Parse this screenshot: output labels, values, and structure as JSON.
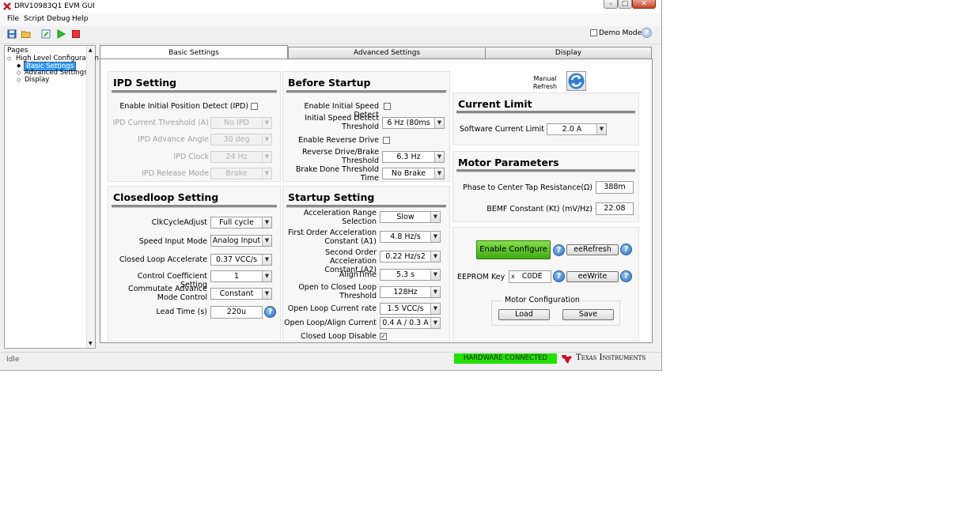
{
  "window": {
    "title": "DRV10983Q1 EVM GUI"
  },
  "menu": [
    "File",
    "Script",
    "Debug",
    "Help"
  ],
  "toolbar": {
    "demo_mode_label": "Demo Mode",
    "demo_mode_checked": false
  },
  "pages_panel": {
    "title": "Pages",
    "root": "High Level Configuration",
    "items": [
      "Basic Settings",
      "Advanced Settings",
      "Display"
    ],
    "selected": "Basic Settings"
  },
  "tabs": [
    "Basic Settings",
    "Advanced Settings",
    "Display"
  ],
  "active_tab": "Basic Settings",
  "ipd": {
    "title": "IPD Setting",
    "enable_label": "Enable Initial Position Detect (IPD)",
    "rows": [
      {
        "label": "IPD Current Threshold (A)",
        "value": "No IPD"
      },
      {
        "label": "IPD Advance Angle",
        "value": "30 deg"
      },
      {
        "label": "IPD Clock",
        "value": "24 Hz"
      },
      {
        "label": "IPD Release Mode",
        "value": "Brake"
      }
    ]
  },
  "before_startup": {
    "title": "Before Startup",
    "enable_isd_label": "Enable Initial Speed Detect",
    "isd_threshold_label": [
      "Initial Speed Detect",
      "Threshold"
    ],
    "isd_threshold_value": "6 Hz (80ms",
    "enable_reverse_label": "Enable Reverse Drive",
    "reverse_threshold_label": [
      "Reverse Drive/Brake",
      "Threshold"
    ],
    "reverse_threshold_value": "6.3 Hz",
    "brake_done_label": [
      "Brake Done Threshold",
      "Time"
    ],
    "brake_done_value": "No Brake"
  },
  "closedloop": {
    "title": "Closedloop Setting",
    "rows": [
      {
        "label": "ClkCycleAdjust",
        "value": "Full cycle"
      },
      {
        "label": "Speed Input Mode",
        "value": "Analog Input"
      },
      {
        "label": "Closed Loop Accelerate",
        "value": "0.37 VCC/s"
      },
      {
        "label": "Control Coefficient Setting",
        "value": "1"
      }
    ],
    "commutate_label": [
      "Commutate Advance",
      "Mode Control"
    ],
    "commutate_value": "Constant",
    "lead_time_label": "Lead Time (s)",
    "lead_time_value": "220u"
  },
  "startup": {
    "title": "Startup Setting",
    "rows": [
      {
        "label": [
          "Acceleration Range",
          "Selection"
        ],
        "value": "Slow"
      },
      {
        "label": [
          "First Order Acceleration",
          "Constant (A1)"
        ],
        "value": "4.8 Hz/s"
      },
      {
        "label": [
          "Second Order Acceleration",
          "Constant (A2)"
        ],
        "value": "0.22 Hz/s2"
      },
      {
        "label": [
          "AlignTime"
        ],
        "value": "5.3 s"
      },
      {
        "label": [
          "Open to Closed Loop",
          "Threshold"
        ],
        "value": "128Hz"
      },
      {
        "label": [
          "Open Loop Current rate"
        ],
        "value": "1.5 VCC/s"
      },
      {
        "label": [
          "Open Loop/Align Current"
        ],
        "value": "0.4 A / 0.3 A"
      }
    ],
    "closed_loop_disable_label": "Closed Loop Disable",
    "closed_loop_disable_checked": true
  },
  "refresh": {
    "label": [
      "Manual",
      "Refresh"
    ]
  },
  "current_limit": {
    "title": "Current Limit",
    "label": "Software Current Limit",
    "value": "2.0 A"
  },
  "motor_params": {
    "title": "Motor Parameters",
    "phase_label": "Phase to Center Tap Resistance(Ω)",
    "phase_value": "388m",
    "bemf_label": "BEMF Constant (Kt) (mV/Hz)",
    "bemf_value": "22.08"
  },
  "eeprom": {
    "enable_configure": "Enable Configure",
    "ee_refresh": "eeRefresh",
    "key_label": "EEPROM Key",
    "key_prefix": "x",
    "key_value": "C0DE",
    "ee_write": "eeWrite",
    "motor_config_title": "Motor Configuration",
    "load": "Load",
    "save": "Save"
  },
  "status": {
    "text": "Idle",
    "hardware": "HARDWARE CONNECTED",
    "brand": "Texas Instruments"
  },
  "colors": {
    "enable_configure_green": "#5cc11f",
    "hardware_green": "#22e000",
    "selection_blue": "#3399ff",
    "ti_red": "#c8102e",
    "stop_red": "#e8343a"
  },
  "icons": [
    "save-icon",
    "open-folder-icon",
    "edit-script-icon",
    "run-icon",
    "stop-icon",
    "help-icon",
    "refresh-icon",
    "ti-logo-icon"
  ]
}
